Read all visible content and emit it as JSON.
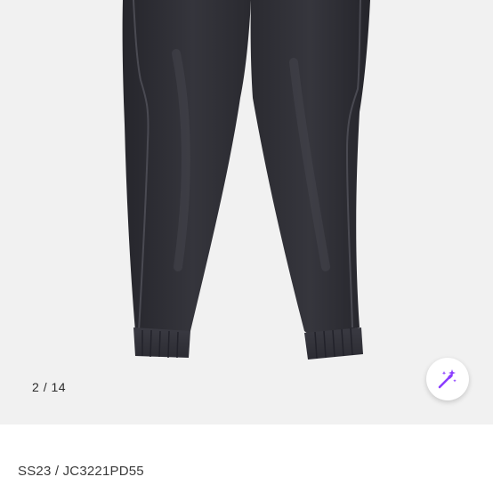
{
  "gallery": {
    "current_page": "2",
    "separator": "/",
    "total_pages": "14",
    "image_subject": "black jogger jeans"
  },
  "actions": {
    "magic_icon": "magic-wand-icon",
    "accent_color": "#8b3dff"
  },
  "product": {
    "code": "SS23 / JC3221PD55"
  }
}
